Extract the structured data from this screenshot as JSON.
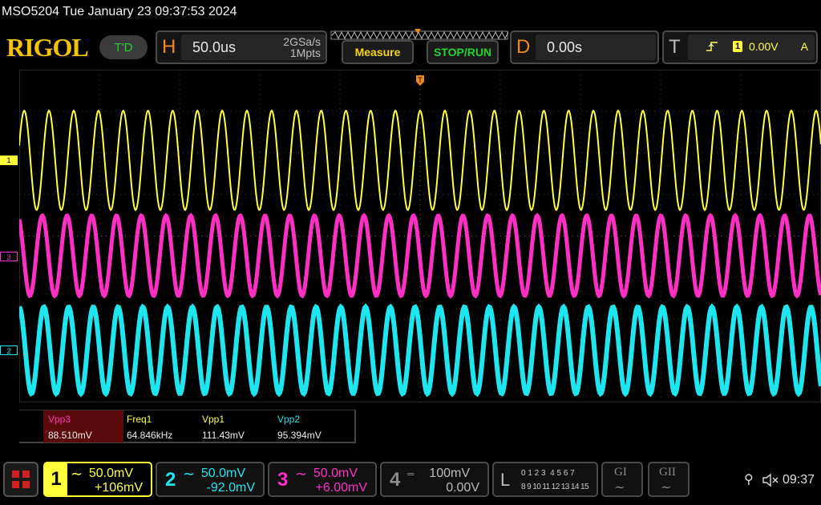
{
  "status": {
    "model_datetime": "MSO5204  Tue January 23 09:37:53 2024"
  },
  "brand": {
    "logo": "RIGOL",
    "mode": "T'D"
  },
  "horizontal": {
    "letter": "H",
    "timebase": "50.0us",
    "sample_rate": "2GSa/s",
    "memory": "1Mpts"
  },
  "buttons": {
    "measure": "Measure",
    "stop_run": "STOP/RUN"
  },
  "delay": {
    "letter": "D",
    "value": "0.00s"
  },
  "trigger": {
    "letter": "T",
    "source": "1",
    "level": "0.00V",
    "mode": "A"
  },
  "channel_markers": {
    "ch1": "1",
    "ch3": "3",
    "ch2": "2"
  },
  "measurements": [
    {
      "name": "Vpp3",
      "value": "88.510mV",
      "color": "#ff2fc6"
    },
    {
      "name": "Freq1",
      "value": "64.846kHz",
      "color": "#ffff3a"
    },
    {
      "name": "Vpp1",
      "value": "111.43mV",
      "color": "#ffff3a"
    },
    {
      "name": "Vpp2",
      "value": "95.394mV",
      "color": "#1ee6f0"
    }
  ],
  "channels": [
    {
      "num": "1",
      "scale": "50.0mV",
      "offset": "+106mV",
      "color": "#ffff3a"
    },
    {
      "num": "2",
      "scale": "50.0mV",
      "offset": "-92.0mV",
      "color": "#1ee6f0"
    },
    {
      "num": "3",
      "scale": "50.0mV",
      "offset": "+6.00mV",
      "color": "#ff2fc6"
    },
    {
      "num": "4",
      "scale": "100mV",
      "offset": "0.00V",
      "color": "#8a8a8a"
    }
  ],
  "logic": {
    "letter": "L",
    "row1": "0 1 2 3  4 5 6 7",
    "row2": "8 9 10 11 12 13 14 15"
  },
  "generators": {
    "g1": "GI",
    "g2": "GII"
  },
  "system": {
    "time": "09:37"
  },
  "colors": {
    "ch1": "#ffff3a",
    "ch2": "#1ee6f0",
    "ch3": "#ff2fc6",
    "accent": "#f08820",
    "green": "#22d22d"
  }
}
